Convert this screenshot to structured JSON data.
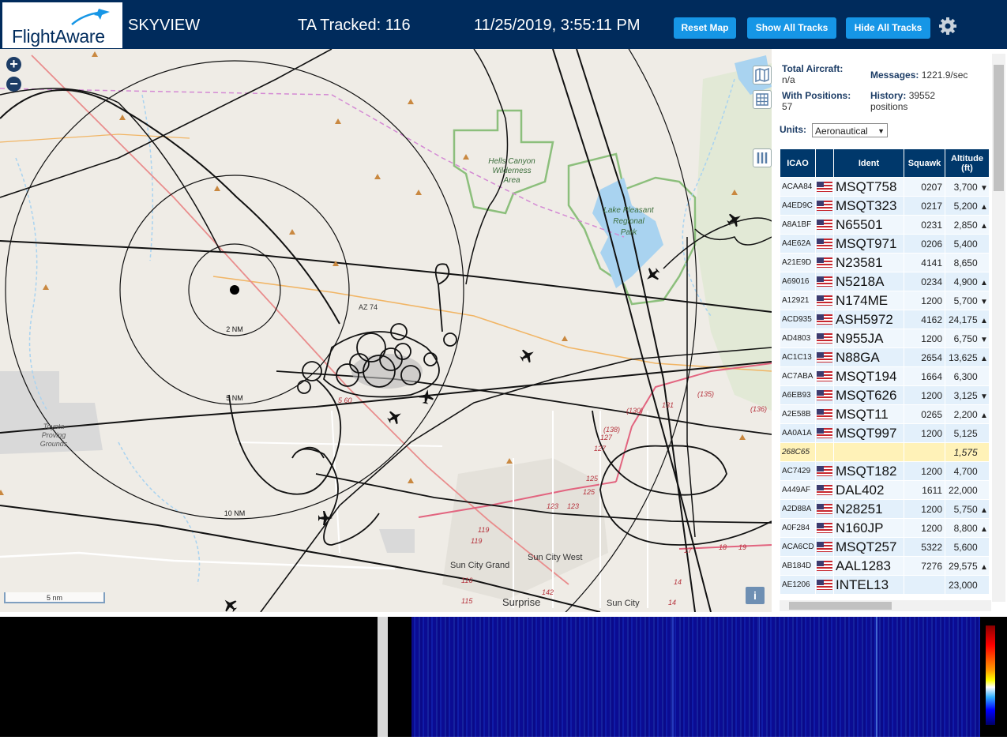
{
  "header": {
    "logo_text": "FlightAware",
    "title": "SKYVIEW",
    "tracked": "TA Tracked: 116",
    "datetime": "11/25/2019, 3:55:11 PM",
    "buttons": {
      "reset_map": "Reset Map",
      "show_all": "Show All Tracks",
      "hide_all": "Hide All Tracks"
    },
    "gear_icon": "gear-icon"
  },
  "map": {
    "labels": {
      "hells_canyon": [
        "Hells Canyon",
        "Wilderness",
        "Area"
      ],
      "lake_pleasant": [
        "Lake Pleasant",
        "Regional",
        "Park"
      ],
      "toyota": [
        "Toyota",
        "Proving",
        "Grounds"
      ],
      "sun_city_grand": "Sun City Grand",
      "sun_city_west": "Sun City West",
      "sun_city": "Sun City",
      "surprise": "Surprise",
      "az74": "AZ 74",
      "ring_2nm": "2 NM",
      "ring_5nm": "5 NM",
      "ring_10nm": "10 NM",
      "elev_130": "(130)",
      "elev_131": "131",
      "elev_135": "(135)",
      "elev_136": "(136)",
      "elev_138": "(138)",
      "elev_127a": "127",
      "elev_127b": "127",
      "elev_125": "125",
      "elev_125b": "125",
      "elev_123": "123",
      "elev_123b": "123",
      "elev_119": "119",
      "elev_119b": "119",
      "elev_116": "116",
      "elev_115": "115",
      "elev_142": "142",
      "elev_17": "17",
      "elev_18": "18",
      "elev_19": "19",
      "elev_14": "14",
      "elev_14b": "14",
      "elev_560": "5 60"
    },
    "zoom_in": "+",
    "zoom_out": "−",
    "scale": "5 nm",
    "info": "i"
  },
  "stats": {
    "total_label": "Total Aircraft:",
    "total_value": "n/a",
    "positions_label": "With Positions:",
    "positions_value": "57",
    "messages_label": "Messages:",
    "messages_value": "1221.9/sec",
    "history_label": "History:",
    "history_value": "39552",
    "history_unit": "positions",
    "units_label": "Units:",
    "units_value": "Aeronautical"
  },
  "table": {
    "headers": {
      "icao": "ICAO",
      "ident": "Ident",
      "squawk": "Squawk",
      "altitude": "Altitude",
      "altitude_unit": "(ft)"
    },
    "rows": [
      {
        "icao": "ACAA84",
        "ident": "MSQT758",
        "squawk": "0207",
        "alt": "3,700",
        "trend": "▼"
      },
      {
        "icao": "A4ED9C",
        "ident": "MSQT323",
        "squawk": "0217",
        "alt": "5,200",
        "trend": "▲"
      },
      {
        "icao": "A8A1BF",
        "ident": "N65501",
        "squawk": "0231",
        "alt": "2,850",
        "trend": "▲"
      },
      {
        "icao": "A4E62A",
        "ident": "MSQT971",
        "squawk": "0206",
        "alt": "5,400",
        "trend": ""
      },
      {
        "icao": "A21E9D",
        "ident": "N23581",
        "squawk": "4141",
        "alt": "8,650",
        "trend": ""
      },
      {
        "icao": "A69016",
        "ident": "N5218A",
        "squawk": "0234",
        "alt": "4,900",
        "trend": "▲"
      },
      {
        "icao": "A12921",
        "ident": "N174ME",
        "squawk": "1200",
        "alt": "5,700",
        "trend": "▼"
      },
      {
        "icao": "ACD935",
        "ident": "ASH5972",
        "squawk": "4162",
        "alt": "24,175",
        "trend": "▲"
      },
      {
        "icao": "AD4803",
        "ident": "N955JA",
        "squawk": "1200",
        "alt": "6,750",
        "trend": "▼"
      },
      {
        "icao": "AC1C13",
        "ident": "N88GA",
        "squawk": "2654",
        "alt": "13,625",
        "trend": "▲"
      },
      {
        "icao": "AC7ABA",
        "ident": "MSQT194",
        "squawk": "1664",
        "alt": "6,300",
        "trend": ""
      },
      {
        "icao": "A6EB93",
        "ident": "MSQT626",
        "squawk": "1200",
        "alt": "3,125",
        "trend": "▼"
      },
      {
        "icao": "A2E58B",
        "ident": "MSQT11",
        "squawk": "0265",
        "alt": "2,200",
        "trend": "▲"
      },
      {
        "icao": "AA0A1A",
        "ident": "MSQT997",
        "squawk": "1200",
        "alt": "5,125",
        "trend": ""
      },
      {
        "icao": "268C65",
        "ident": "",
        "squawk": "",
        "alt": "1,575",
        "trend": "",
        "highlight": true
      },
      {
        "icao": "AC7429",
        "ident": "MSQT182",
        "squawk": "1200",
        "alt": "4,700",
        "trend": ""
      },
      {
        "icao": "A449AF",
        "ident": "DAL402",
        "squawk": "1611",
        "alt": "22,000",
        "trend": ""
      },
      {
        "icao": "A2D88A",
        "ident": "N28251",
        "squawk": "1200",
        "alt": "5,750",
        "trend": "▲"
      },
      {
        "icao": "A0F284",
        "ident": "N160JP",
        "squawk": "1200",
        "alt": "8,800",
        "trend": "▲"
      },
      {
        "icao": "ACA6CD",
        "ident": "MSQT257",
        "squawk": "5322",
        "alt": "5,600",
        "trend": ""
      },
      {
        "icao": "AB184D",
        "ident": "AAL1283",
        "squawk": "7276",
        "alt": "29,575",
        "trend": "▲"
      },
      {
        "icao": "AE1206",
        "ident": "INTEL13",
        "squawk": "",
        "alt": "23,000",
        "trend": ""
      }
    ]
  }
}
